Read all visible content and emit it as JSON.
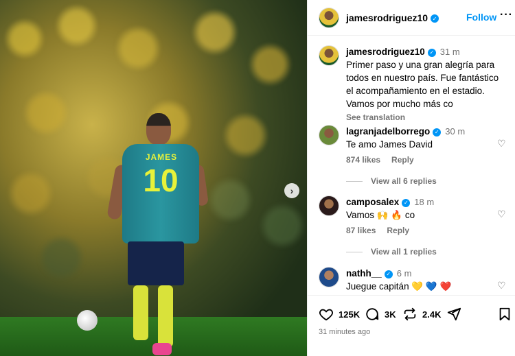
{
  "post": {
    "username": "jamesrodriguez10",
    "follow_label": "Follow",
    "more_label": "···",
    "jersey_name": "JAMES",
    "jersey_number": "10",
    "caption": {
      "time": "31 m",
      "text": "Primer paso y una gran alegría para todos en nuestro país. Fue fantástico el acompañamiento en el estadio. Vamos por mucho más co",
      "see_translation": "See translation"
    }
  },
  "comments": [
    {
      "username": "lagranjadelborrego",
      "time": "30 m",
      "text": "Te amo James David",
      "likes": "874 likes",
      "reply": "Reply",
      "view_replies": "View all 6 replies"
    },
    {
      "username": "camposalex",
      "time": "18 m",
      "text": "Vamos 🙌 🔥 co",
      "likes": "87 likes",
      "reply": "Reply",
      "view_replies": "View all 1 replies"
    },
    {
      "username": "nathh__",
      "time": "6 m",
      "text": "Juegue capitán 💛 💙 ❤️"
    }
  ],
  "actions": {
    "likes": "125K",
    "comments": "3K",
    "reposts": "2.4K",
    "posted_ago": "31 minutes ago"
  },
  "colors": {
    "accent": "#0095f6",
    "muted": "#737373",
    "jersey": "#2a96a0",
    "jersey_text": "#e7f23a"
  }
}
